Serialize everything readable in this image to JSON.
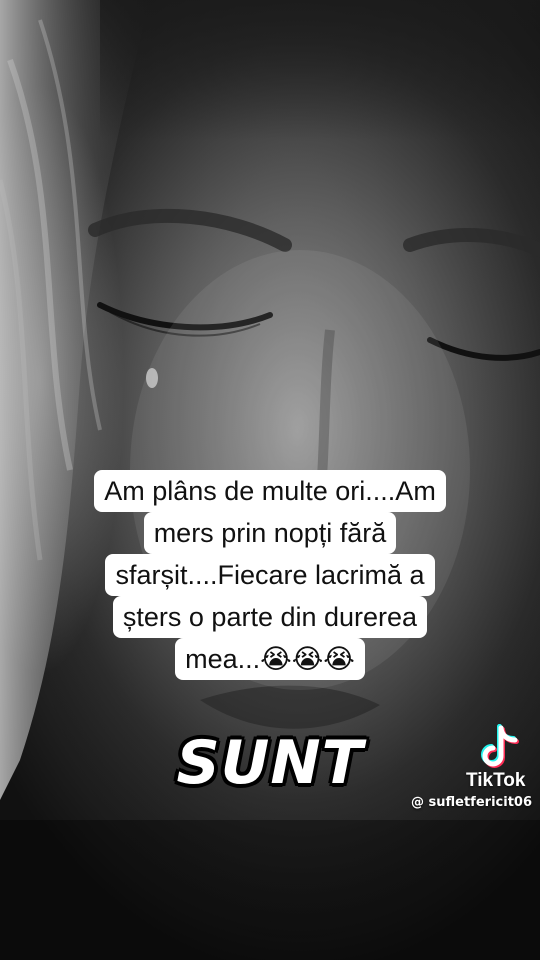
{
  "caption": {
    "lines": [
      "Am plâns de multe ori....Am",
      "mers prin nopți fără",
      "sfarșit....Fiecare lacrimă a",
      "șters o parte din durerea",
      "mea...😭😭😭"
    ]
  },
  "overlay_word": "SUNT",
  "watermark": {
    "brand": "TikTok",
    "username": "@ sufletfericit06",
    "icon": "tiktok-logo-icon"
  },
  "colors": {
    "caption_bg": "#ffffff",
    "caption_text": "#111111",
    "overlay_text": "#ffffff",
    "logo_cyan": "#25f4ee",
    "logo_red": "#fe2c55"
  }
}
